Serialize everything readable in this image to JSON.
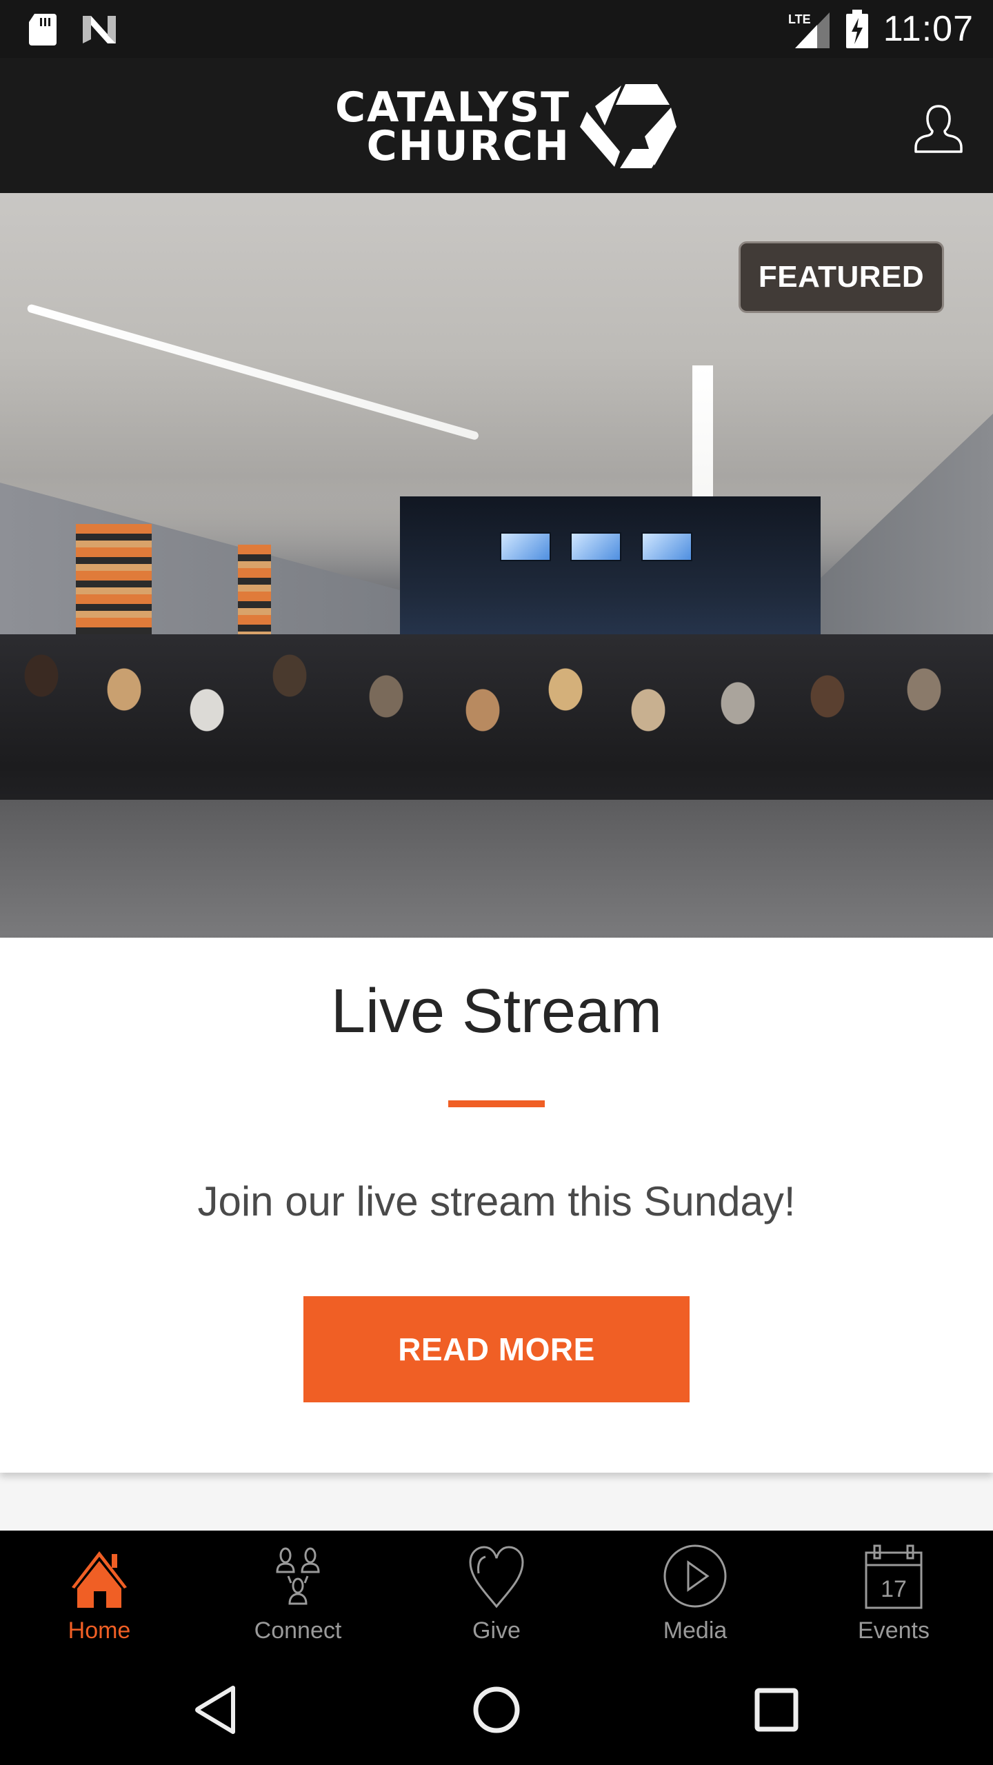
{
  "status_bar": {
    "time": "11:07",
    "network": "LTE",
    "icons": [
      "sd-card-icon",
      "n-notification-icon",
      "lte-signal-icon",
      "battery-charging-icon"
    ]
  },
  "header": {
    "logo_line1": "CATALYST",
    "logo_line2": "CHURCH",
    "profile_icon": "user-profile-icon"
  },
  "hero": {
    "badge": "FEATURED",
    "image_alt": "Congregation seated facing stage with three Catalyst Church screens"
  },
  "card": {
    "title": "Live Stream",
    "description": "Join our live stream this Sunday!",
    "button_label": "READ MORE"
  },
  "bottom_nav": {
    "items": [
      {
        "label": "Home",
        "icon": "home-icon",
        "active": true
      },
      {
        "label": "Connect",
        "icon": "people-icon",
        "active": false
      },
      {
        "label": "Give",
        "icon": "heart-icon",
        "active": false
      },
      {
        "label": "Media",
        "icon": "play-circle-icon",
        "active": false
      },
      {
        "label": "Events",
        "icon": "calendar-icon",
        "calendar_day": "17",
        "active": false
      }
    ]
  },
  "system_nav": {
    "buttons": [
      "back",
      "home",
      "recents"
    ]
  },
  "colors": {
    "accent": "#f05f25",
    "header_bg": "#1a1a1a",
    "nav_bg": "#000000",
    "inactive_nav": "#9a9a9a",
    "badge_bg": "#413b37"
  }
}
